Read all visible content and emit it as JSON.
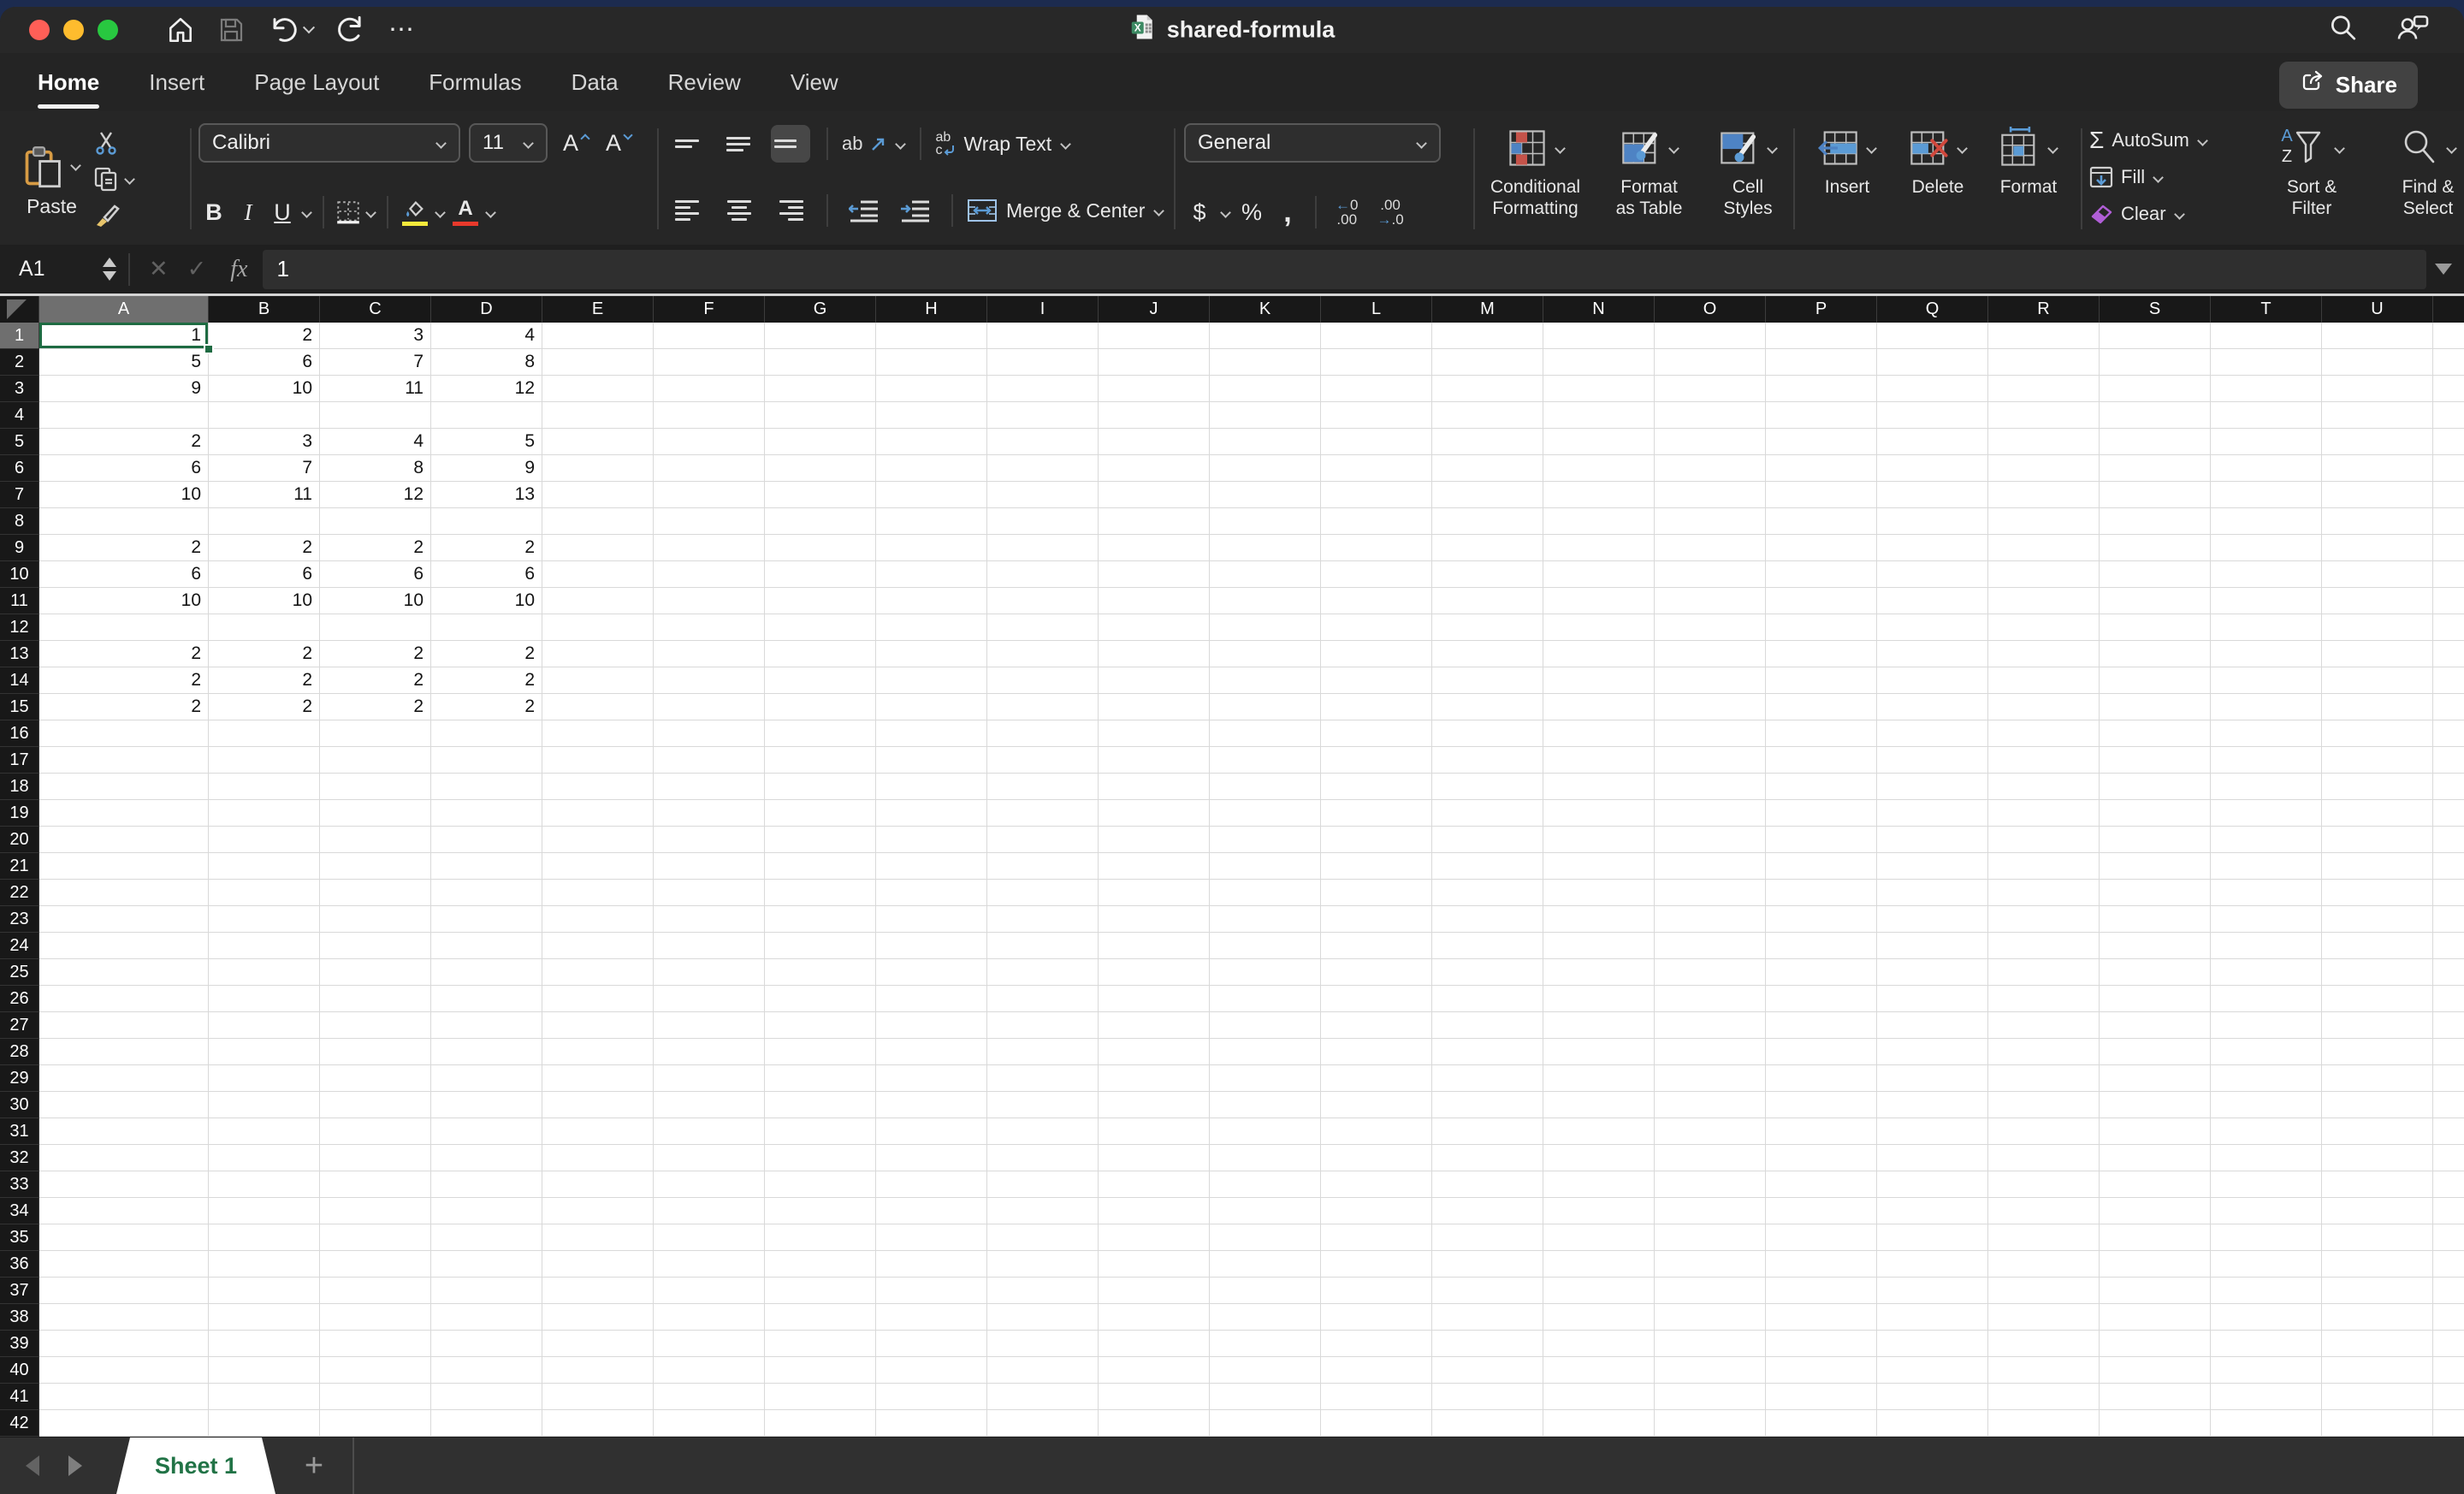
{
  "window": {
    "title": "shared-formula"
  },
  "tabs": {
    "items": [
      "Home",
      "Insert",
      "Page Layout",
      "Formulas",
      "Data",
      "Review",
      "View"
    ],
    "active": "Home"
  },
  "share": {
    "label": "Share"
  },
  "ribbon": {
    "paste_label": "Paste",
    "font_name": "Calibri",
    "font_size": "11",
    "glyphs": {
      "bold": "B",
      "italic": "I",
      "underline": "U",
      "grow_font": "A",
      "shrink_font": "A",
      "orientation": "ab",
      "wrap_ab": "ab",
      "wrap_c": "c",
      "currency": "$",
      "percent": "%",
      "comma": ",",
      "autosum_sigma": "Σ",
      "font_color_a": "A",
      "dec_left_top": "0",
      "dec_left_bottom": ".00",
      "dec_right_top": ".00",
      "dec_right_bottom": ".0",
      "sort_a": "A",
      "sort_z": "Z",
      "ellipsis": "⋯",
      "cancel": "✕",
      "enter": "✓",
      "fx": "fx",
      "add_sheet": "+"
    },
    "wrap_text_label": "Wrap Text",
    "merge_center_label": "Merge & Center",
    "number_format": "General",
    "conditional_formatting_label": "Conditional\nFormatting",
    "format_as_table_label": "Format\nas Table",
    "cell_styles_label": "Cell\nStyles",
    "insert_label": "Insert",
    "delete_label": "Delete",
    "format_label": "Format",
    "autosum_label": "AutoSum",
    "fill_label": "Fill",
    "clear_label": "Clear",
    "sort_filter_label": "Sort &\nFilter",
    "find_select_label": "Find &\nSelect"
  },
  "formula_bar": {
    "name_box": "A1",
    "formula": "1"
  },
  "grid": {
    "columns": [
      "A",
      "B",
      "C",
      "D",
      "E",
      "F",
      "G",
      "H",
      "I",
      "J",
      "K",
      "L",
      "M",
      "N",
      "O",
      "P",
      "Q",
      "R",
      "S",
      "T",
      "U"
    ],
    "row_count": 42,
    "selected_cell": "A1",
    "cell_rows": [
      {
        "row": 1,
        "values": [
          "1",
          "2",
          "3",
          "4"
        ]
      },
      {
        "row": 2,
        "values": [
          "5",
          "6",
          "7",
          "8"
        ]
      },
      {
        "row": 3,
        "values": [
          "9",
          "10",
          "11",
          "12"
        ]
      },
      {
        "row": 5,
        "values": [
          "2",
          "3",
          "4",
          "5"
        ]
      },
      {
        "row": 6,
        "values": [
          "6",
          "7",
          "8",
          "9"
        ]
      },
      {
        "row": 7,
        "values": [
          "10",
          "11",
          "12",
          "13"
        ]
      },
      {
        "row": 9,
        "values": [
          "2",
          "2",
          "2",
          "2"
        ]
      },
      {
        "row": 10,
        "values": [
          "6",
          "6",
          "6",
          "6"
        ]
      },
      {
        "row": 11,
        "values": [
          "10",
          "10",
          "10",
          "10"
        ]
      },
      {
        "row": 13,
        "values": [
          "2",
          "2",
          "2",
          "2"
        ]
      },
      {
        "row": 14,
        "values": [
          "2",
          "2",
          "2",
          "2"
        ]
      },
      {
        "row": 15,
        "values": [
          "2",
          "2",
          "2",
          "2"
        ]
      }
    ]
  },
  "sheet_bar": {
    "tabs": [
      "Sheet 1"
    ],
    "active": "Sheet 1"
  },
  "colors": {
    "selection_green": "#1e6b42",
    "sheet_tab_green": "#217346",
    "header_highlight": "#6f6f6f",
    "fill_yellow": "#f4e93b",
    "font_red": "#e8392b",
    "icon_blue": "#5b9bd5",
    "icon_red": "#c4534a",
    "clear_purple": "#b05ed6",
    "paste_orange": "#d79b44",
    "traffic_red": "#ff5f57",
    "traffic_yellow": "#febc2e",
    "traffic_green": "#28c840"
  }
}
